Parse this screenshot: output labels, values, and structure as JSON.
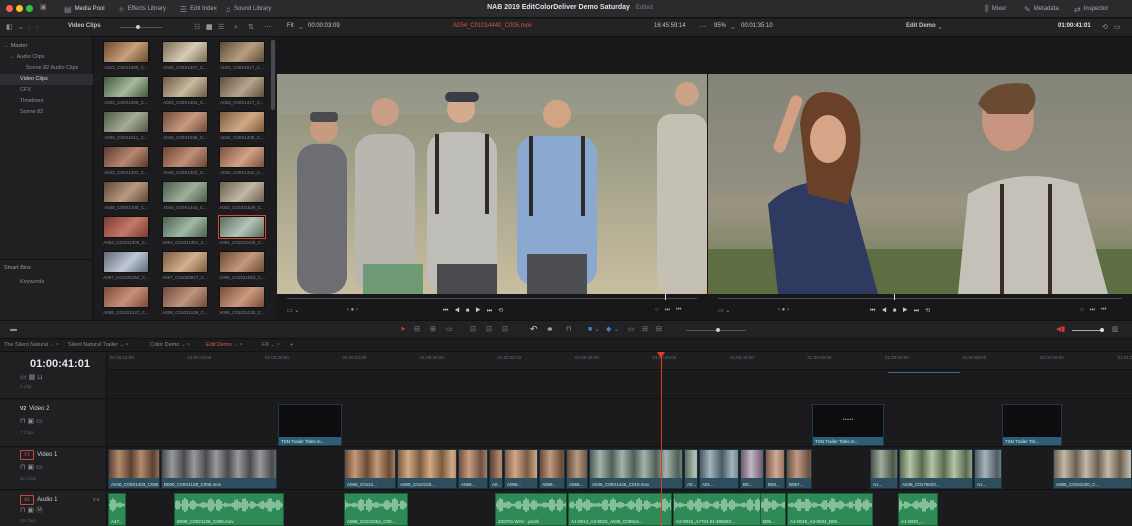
{
  "titlebar": {
    "tabs": [
      {
        "label": "Media Pool",
        "icon": "media-pool-icon"
      },
      {
        "label": "Effects Library",
        "icon": "effects-icon"
      },
      {
        "label": "Edit Index",
        "icon": "edit-index-icon"
      },
      {
        "label": "Sound Library",
        "icon": "sound-library-icon"
      }
    ],
    "title": "NAB 2019 EditColorDeliver Demo Saturday",
    "subtitle": "Edited",
    "right_tabs": [
      {
        "label": "Mixer",
        "icon": "mixer-icon"
      },
      {
        "label": "Metadata",
        "icon": "metadata-icon"
      },
      {
        "label": "Inspector",
        "icon": "inspector-icon"
      }
    ]
  },
  "toolbar2": {
    "bin_label": "Video Clips",
    "fit_label": "Fit",
    "source_timecode_left": "00:00:03:09",
    "source_clip": "A054_C01014440_C005.mov",
    "source_timecode_right": "16:45:59:14",
    "zoom": "95%",
    "record_duration": "00:01:35:10",
    "timeline_name": "Edit Demo",
    "record_timecode": "01:00:41:01"
  },
  "sidebar": {
    "master_label": "Master",
    "items": [
      {
        "label": "Audio Clips",
        "level": 1
      },
      {
        "label": "Scene 82 Audio Clips",
        "level": 2
      },
      {
        "label": "Video Clips",
        "level": 1,
        "selected": true
      },
      {
        "label": "CFX",
        "level": 1
      },
      {
        "label": "Timelines",
        "level": 1
      },
      {
        "label": "Scene 82",
        "level": 1
      }
    ],
    "smart_bins_label": "Smart Bins",
    "smart_items": [
      {
        "label": "Keywords"
      }
    ]
  },
  "thumbs": [
    {
      "cap": "A012_C00X1009_C...",
      "c1": "#6b4a30",
      "c2": "#c8a07a"
    },
    {
      "cap": "A025_C00X1407_C...",
      "c1": "#7a6a52",
      "c2": "#d8cbb4"
    },
    {
      "cap": "A022_C00X1517_C...",
      "c1": "#5a4a3a",
      "c2": "#b99e80"
    },
    {
      "cap": "A023_C00X1005_C...",
      "c1": "#3c5a3a",
      "c2": "#a8b89a"
    },
    {
      "cap": "A023_C00X1401_C...",
      "c1": "#6a5a44",
      "c2": "#c8b8a0"
    },
    {
      "cap": "A023_C00X1417_C...",
      "c1": "#5c4e3e",
      "c2": "#b8a48c"
    },
    {
      "cap": "A026_C00X1011_C...",
      "c1": "#4e5a48",
      "c2": "#a4ac98"
    },
    {
      "cap": "A026_C00X1036_C...",
      "c1": "#6e4a3a",
      "c2": "#c89a80"
    },
    {
      "cap": "A042_C00X1435_C...",
      "c1": "#7a5a3e",
      "c2": "#d0aa84"
    },
    {
      "cap": "A040_C00X1401_C...",
      "c1": "#5a3a2e",
      "c2": "#b88870"
    },
    {
      "cap": "A040_C00X1403_C...",
      "c1": "#6a4232",
      "c2": "#c09078"
    },
    {
      "cap": "A040_C00X1442_C...",
      "c1": "#7a5040",
      "c2": "#d2a286"
    },
    {
      "cap": "A040_C00X1400_C...",
      "c1": "#5e4636",
      "c2": "#b89a80"
    },
    {
      "cap": "A040_C00X1444_C...",
      "c1": "#4a5a4a",
      "c2": "#9eb09a"
    },
    {
      "cap": "A053_C01011539_C...",
      "c1": "#6a5e4e",
      "c2": "#c4b8a2"
    },
    {
      "cap": "A053_C01011305_C...",
      "c1": "#7a3a30",
      "c2": "#c4786a"
    },
    {
      "cap": "A054_C01011351_C...",
      "c1": "#4a6050",
      "c2": "#a0b8a4"
    },
    {
      "cap": "A054_C01014440_C...",
      "c1": "#5a6a5e",
      "c2": "#b4c4b6",
      "selected": true
    },
    {
      "cap": "A057_C01020152_C...",
      "c1": "#5e6a7a",
      "c2": "#c0c8d4"
    },
    {
      "cap": "A057_C01020817_C...",
      "c1": "#7a5a40",
      "c2": "#d4b08c"
    },
    {
      "cap": "A058_C01021054_C...",
      "c1": "#6a4a38",
      "c2": "#c49a7c"
    },
    {
      "cap": "A058_C01021137_C...",
      "c1": "#7a4a3a",
      "c2": "#c8907a"
    },
    {
      "cap": "A058_C01021139_C...",
      "c1": "#6c4a3c",
      "c2": "#c29480"
    },
    {
      "cap": "A058_C01021132_C...",
      "c1": "#744e3a",
      "c2": "#cc9a7e"
    }
  ],
  "timeline_tabs": [
    {
      "label": "The Silent Natural"
    },
    {
      "label": "Silent Natural Trailer"
    },
    {
      "label": "Color Demo"
    },
    {
      "label": "Edit Demo",
      "active": true
    },
    {
      "label": "FX"
    }
  ],
  "timeline": {
    "timecode": "01:00:41:01",
    "ruler_ticks": [
      "01:00:12:00",
      "01:00:16:00",
      "01:00:20:00",
      "01:00:24:00",
      "01:00:28:00",
      "01:00:32:00",
      "01:00:36:00",
      "01:00:40:00",
      "01:00:44:00",
      "01:00:48:00",
      "01:00:52:00",
      "01:00:56:00",
      "01:01:00:00",
      "01:01:04:00"
    ],
    "tracks": {
      "v2": {
        "badge": "V2",
        "name": "Video 2",
        "clips": "7 Clips"
      },
      "v1": {
        "badge": "V1",
        "name": "Video 1",
        "clips": "32 Clips"
      },
      "a1": {
        "badge": "A1",
        "name": "Audio 1",
        "gain": "2.0",
        "clips": "19 Clips"
      },
      "top": {
        "clips": "0 Clip"
      }
    },
    "title_clips": [
      {
        "name": "TSN Trailer Titles.m...",
        "text": ""
      },
      {
        "name": "TSN Trailer Titles.m...",
        "text": "••••••"
      },
      {
        "name": "TSN Trailer Titl...",
        "text": ""
      }
    ],
    "video_clips": [
      {
        "name": "A040_C00X1403_C006.mov",
        "c1": "#5a4030",
        "c2": "#b48a6e"
      },
      {
        "name": "B009_C00X1128_C006.mov",
        "c1": "#4a4a4c",
        "c2": "#9a9a9e"
      },
      {
        "name": "A058_C0121...",
        "c1": "#6a4a34",
        "c2": "#c49a7a"
      },
      {
        "name": "A059_C012120...",
        "c1": "#7a5a3e",
        "c2": "#d2aa86"
      },
      {
        "name": "A058...",
        "c1": "#6e5040",
        "c2": "#c89c80"
      },
      {
        "name": "A0...",
        "c1": "#5a4234",
        "c2": "#b48a70"
      },
      {
        "name": "A058...",
        "c1": "#7a5a44",
        "c2": "#d0a888"
      },
      {
        "name": "A059...",
        "c1": "#684a3a",
        "c2": "#c09a7e"
      },
      {
        "name": "A058...",
        "c1": "#5e4a3c",
        "c2": "#b89a82"
      },
      {
        "name": "A046_C00X1446_C010.mov",
        "c1": "#4e5e56",
        "c2": "#a4b4aa"
      },
      {
        "name": "A0...",
        "c1": "#5a6a60",
        "c2": "#b0c0b4"
      },
      {
        "name": "A01...",
        "c1": "#4a5a62",
        "c2": "#a4b4bc"
      },
      {
        "name": "B0...",
        "c1": "#6a5a6a",
        "c2": "#c4b4c4"
      },
      {
        "name": "B00...",
        "c1": "#7a5a4a",
        "c2": "#d0aa96"
      },
      {
        "name": "B057...",
        "c1": "#6a4e3e",
        "c2": "#c09c84"
      },
      {
        "name": "A1...",
        "c1": "#4a5448",
        "c2": "#a0ac9c"
      },
      {
        "name": "A048_C0170620...",
        "c1": "#5a6a50",
        "c2": "#b4c4a4"
      },
      {
        "name": "A1...",
        "c1": "#4e5a62",
        "c2": "#a6b4bc"
      },
      {
        "name": "A085_C0161020_C...",
        "c1": "#6a5e50",
        "c2": "#c4b8a8"
      }
    ],
    "audio_clips": [
      {
        "name": "A47..."
      },
      {
        "name": "B009_C0021128_C006.mov"
      },
      {
        "name": "A058_C0121054_C00..."
      },
      {
        "name": "Z28701.WAV - jacob"
      },
      {
        "name": "A1-0014_A3-0023_A046_C00914..."
      },
      {
        "name": "A2-0015_A7704.01:495583..."
      },
      {
        "name": "B05..."
      },
      {
        "name": "A1-0018_A3-0034_B05..."
      },
      {
        "name": "A1-0020_..."
      }
    ]
  },
  "viewer": {
    "left_controls": [
      "◂ ● ▸"
    ],
    "right_controls": [
      "◂ ● ▸"
    ]
  },
  "colors": {
    "accent_red": "#e0382a",
    "video_clip": "#2d4e5e",
    "audio_clip": "#2f8b55",
    "selection": "#d44636"
  }
}
